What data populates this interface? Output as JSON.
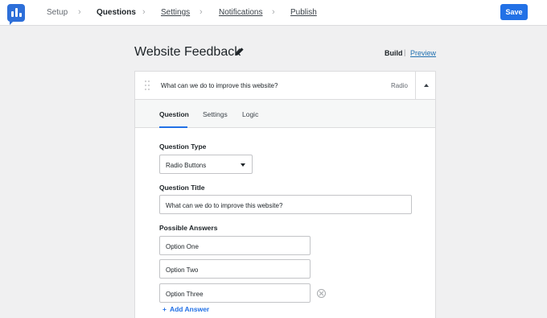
{
  "nav": {
    "steps": [
      "Setup",
      "Questions",
      "Settings",
      "Notifications",
      "Publish"
    ],
    "save_label": "Save"
  },
  "header": {
    "title": "Website Feedback",
    "build_label": "Build",
    "separator": "|",
    "preview_label": "Preview"
  },
  "question": {
    "text": "What can we do to improve this website?",
    "type": "Radio",
    "tabs": [
      "Question",
      "Settings",
      "Logic"
    ],
    "type_label": "Question Type",
    "type_value": "Radio Buttons",
    "title_label": "Question Title",
    "title_value": "What can we do to improve this website?",
    "answers_label": "Possible Answers",
    "answers": [
      "Option One",
      "Option Two",
      "Option Three"
    ],
    "add_answer_label": "Add Answer"
  },
  "colors": {
    "accent": "#2271e6",
    "background": "#f0f0f1"
  }
}
